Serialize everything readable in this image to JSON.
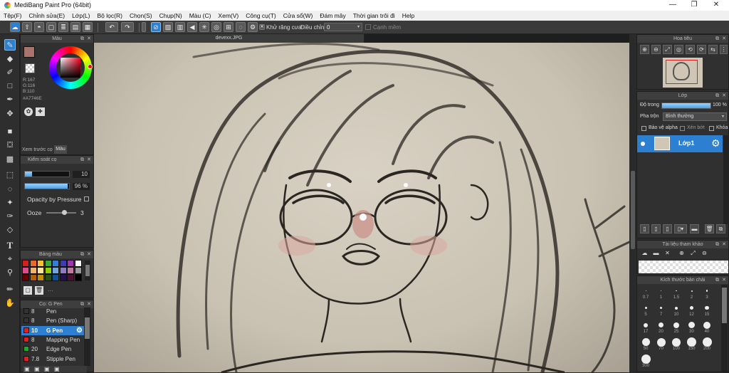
{
  "window": {
    "title": "MediBang Paint Pro (64bit)",
    "controls": [
      "—",
      "❐",
      "✕"
    ]
  },
  "menu": [
    "Tệp(F)",
    "Chỉnh sửa(E)",
    "Lớp(L)",
    "Bộ lọc(R)",
    "Chọn(S)",
    "Chụp(N)",
    "Màu (C)",
    "Xem(V)",
    "Công cụ(T)",
    "Cửa sổ(W)",
    "Đám mây",
    "Thời gian trôi đi",
    "Help"
  ],
  "toolbar": {
    "antialias_label": "Khử răng cưa",
    "adjust_label": "Điều chỉnh",
    "adjust_value": "0",
    "sharp_label": "Cạnh mềm"
  },
  "document": {
    "tab_name": "devexx.JPG"
  },
  "color_panel": {
    "title": "Màu",
    "r": "R:167",
    "g": "G:116",
    "b": "B:110",
    "hex": "#A7746E",
    "fg_color": "#A7746E",
    "bg_color": "#FFFFFF",
    "tab_preview": "Xem trước cọ",
    "tab_color": "Màu"
  },
  "brush_control": {
    "title": "Kiểm soát cọ",
    "size_value": "10",
    "size_fill": 0.16,
    "opacity_value": "96 %",
    "opacity_fill": 0.96,
    "pressure_label": "Opacity by Pressure",
    "ooze_label": "Ooze",
    "ooze_value": "3"
  },
  "palette": {
    "title": "Bảng màu",
    "colors": [
      "#d02020",
      "#e86a2a",
      "#f1c232",
      "#38a838",
      "#2f7fd6",
      "#3d3db0",
      "#a035b0",
      "#ffffff",
      "#e44a8a",
      "#f6b26b",
      "#ffe599",
      "#8fce00",
      "#6fa8dc",
      "#8e7cc3",
      "#c27ba0",
      "#999999",
      "#660000",
      "#b45f06",
      "#bf9000",
      "#274e13",
      "#0b5394",
      "#20124d",
      "#4c1130",
      "#000000"
    ],
    "more_label": "···"
  },
  "brush_list": {
    "title": "Cọ: G Pen",
    "items": [
      {
        "size": "8",
        "name": "Pen",
        "color": "#333333"
      },
      {
        "size": "8",
        "name": "Pen (Sharp)",
        "color": "#333333"
      },
      {
        "size": "10",
        "name": "G Pen",
        "color": "#e02020",
        "selected": true
      },
      {
        "size": "8",
        "name": "Mapping Pen",
        "color": "#e02020"
      },
      {
        "size": "20",
        "name": "Edge Pen",
        "color": "#22aa22"
      },
      {
        "size": "7.8",
        "name": "Stipple Pen",
        "color": "#e02020"
      }
    ]
  },
  "navigator": {
    "title": "Hoa tiêu"
  },
  "layers": {
    "title": "Lớp",
    "opacity_label": "Độ trong",
    "opacity_value": "100 %",
    "opacity_fill": 1.0,
    "blend_label": "Pha trộn",
    "blend_value": "Bình thường",
    "protect_alpha": "Bảo vệ alpha",
    "clipping": "Xén bớt",
    "lock": "Khóa",
    "layer_name": "Lớp1"
  },
  "reference": {
    "title": "Tài liệu tham khảo"
  },
  "brush_size": {
    "title": "Kích thước bàn chải",
    "sizes": [
      "0.7",
      "1",
      "1.5",
      "2",
      "3",
      "5",
      "7",
      "10",
      "12",
      "15",
      "17",
      "20",
      "25",
      "30",
      "40",
      "50",
      "70",
      "100",
      "150",
      "200",
      "300"
    ]
  },
  "icons": {
    "tools": [
      "brush-icon",
      "eraser-icon",
      "blur-icon",
      "rect-icon",
      "pen-icon",
      "move-icon",
      "fill-rect-icon",
      "bucket-icon",
      "gradient-icon",
      "select-rect-icon",
      "lasso-icon",
      "magic-wand-icon",
      "select-pen-icon",
      "select-eraser-icon",
      "text-icon",
      "operation-icon",
      "eyedropper-icon",
      "eyedropper2-icon",
      "hand-icon"
    ]
  }
}
